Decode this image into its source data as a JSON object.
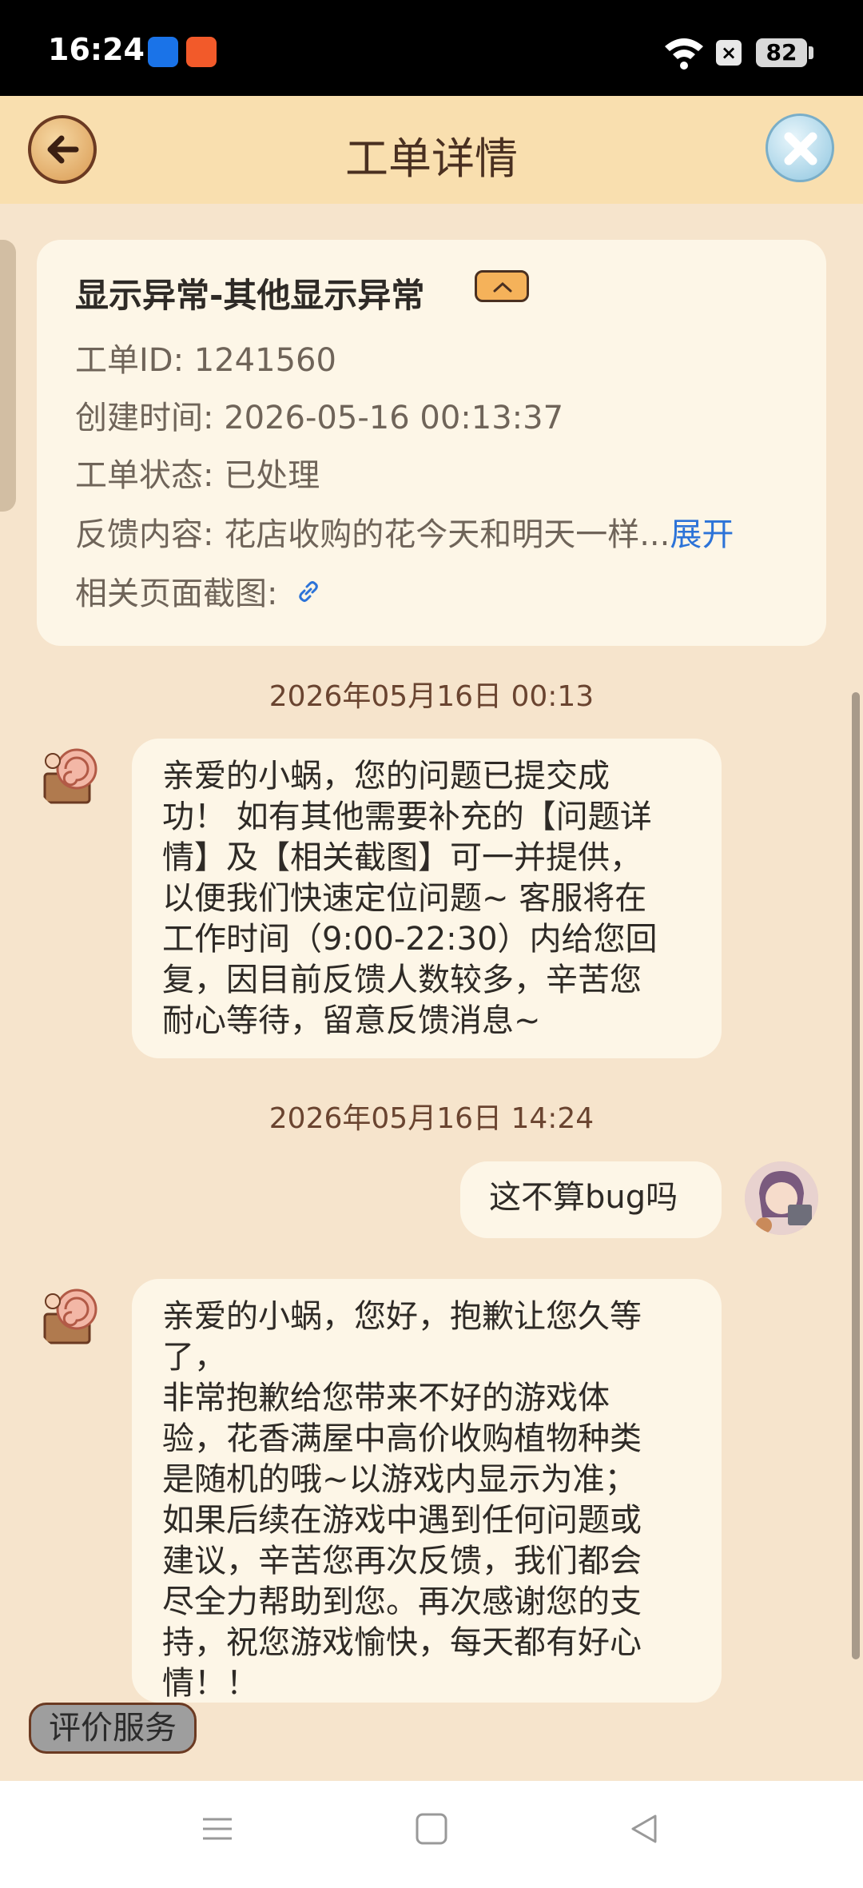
{
  "status_bar": {
    "time": "16:24",
    "battery": "82"
  },
  "header": {
    "title": "工单详情"
  },
  "ticket": {
    "title": "显示异常-其他显示异常",
    "id_line": "工单ID: 1241560",
    "created_line": "创建时间: 2026-05-16 00:13:37",
    "status_line": "工单状态: 已处理",
    "feedback_label": "反馈内容: 花店收购的花今天和明天一样...",
    "feedback_expand": "展开",
    "screenshot_label": "相关页面截图: "
  },
  "messages": [
    {
      "timestamp": "2026年05月16日 00:13",
      "sender": "agent",
      "text": "亲爱的小蜗，您的问题已提交成\n功！ 如有其他需要补充的【问题详\n情】及【相关截图】可一并提供，\n以便我们快速定位问题~ 客服将在\n工作时间（9:00-22:30）内给您回\n复，因目前反馈人数较多，辛苦您\n耐心等待，留意反馈消息~"
    },
    {
      "timestamp": "2026年05月16日 14:24",
      "sender": "user",
      "text": "这不算bug吗"
    },
    {
      "sender": "agent",
      "text": "亲爱的小蜗，您好，抱歉让您久等\n了，\n非常抱歉给您带来不好的游戏体\n验，花香满屋中高价收购植物种类\n是随机的哦~以游戏内显示为准；\n如果后续在游戏中遇到任何问题或\n建议，辛苦您再次反馈，我们都会\n尽全力帮助到您。再次感谢您的支\n持，祝您游戏愉快，每天都有好心\n情！！"
    }
  ],
  "rate_button": "评价服务",
  "icons": {
    "back": "back-arrow-icon",
    "close": "close-icon",
    "collapse": "chevron-up-icon",
    "link": "link-icon",
    "nav": [
      "menu-icon",
      "home-icon",
      "back-triangle-icon"
    ]
  },
  "colors": {
    "header_bg": "#f9dfaf",
    "page_bg": "#f6e4cc",
    "card_bg": "#fdf6e7",
    "link": "#2c73d8"
  }
}
